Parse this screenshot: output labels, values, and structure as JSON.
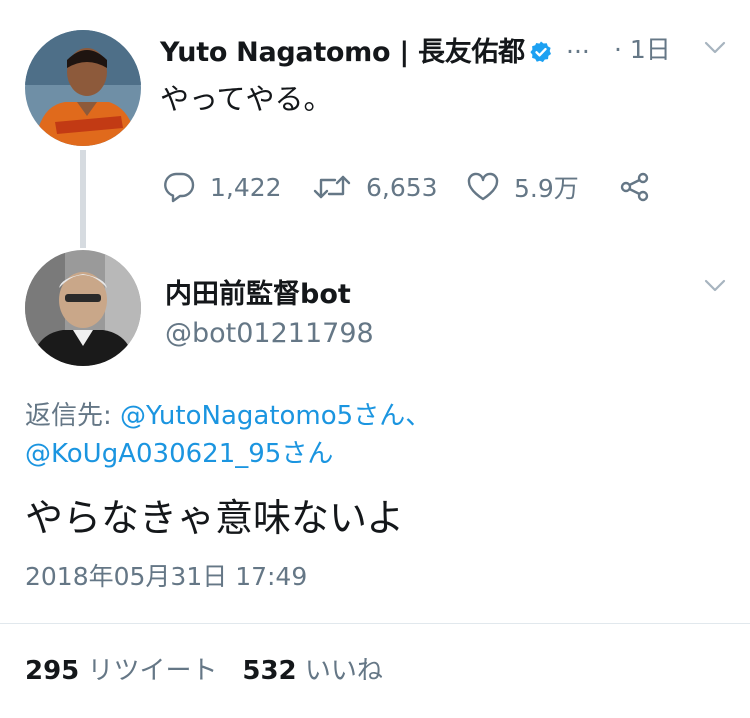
{
  "original_tweet": {
    "author_name": "Yuto Nagatomo | 長友佑都",
    "truncation": "...",
    "time": "· 1日",
    "text": "やってやる。",
    "reply_count": "1,422",
    "retweet_count": "6,653",
    "like_count": "5.9万"
  },
  "reply_tweet": {
    "author_name": "内田前監督bot",
    "handle": "@bot01211798",
    "reply_to_prefix": "返信先: ",
    "reply_to_mention_1": "@YutoNagatomo5さん、",
    "reply_to_mention_2": "@KoUgA030621_95さん",
    "text": "やらなきゃ意味ないよ",
    "timestamp": "2018年05月31日 17:49",
    "retweet_count": "295",
    "retweet_label": "リツイート",
    "like_count": "532",
    "like_label": "いいね"
  },
  "colors": {
    "text_primary": "#14171a",
    "text_secondary": "#657786",
    "link": "#1b95e0",
    "verified": "#1da1f2",
    "thread_line": "#d6dbe0"
  },
  "icons": [
    "reply-icon",
    "retweet-icon",
    "like-icon",
    "share-icon",
    "verified-badge-icon",
    "chevron-down-icon"
  ]
}
